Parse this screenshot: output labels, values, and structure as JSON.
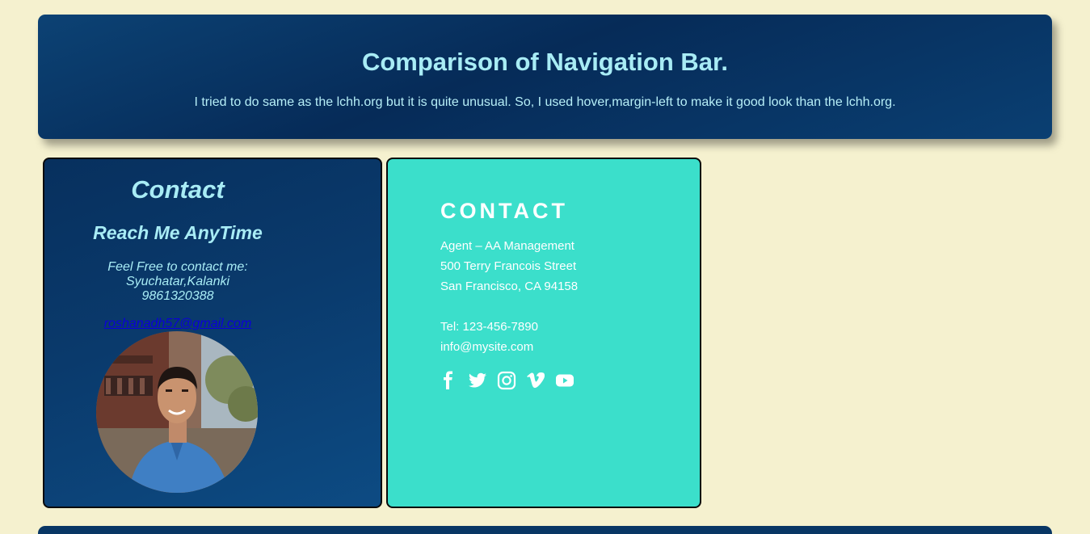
{
  "header": {
    "title": "Comparison of Navigation Bar.",
    "description": "I tried to do same as the lchh.org but it is quite unusual. So, I used hover,margin-left to make it good look than the lchh.org."
  },
  "left_card": {
    "title": "Contact",
    "subtitle": "Reach Me AnyTime",
    "line1": "Feel Free to contact me:",
    "line2": "Syuchatar,Kalanki",
    "line3": "9861320388",
    "email": "roshanadh57@gmail.com",
    "photo_icon": "profile-photo"
  },
  "right_card": {
    "title": "CONTACT",
    "address1": "Agent – AA  Management",
    "address2": "500 Terry Francois Street",
    "address3": "San Francisco, CA 94158",
    "tel": "Tel: 123-456-7890",
    "email": "info@mysite.com",
    "social_icons": [
      "facebook-icon",
      "twitter-icon",
      "instagram-icon",
      "vimeo-icon",
      "youtube-icon"
    ]
  },
  "colors": {
    "background": "#f5f1cf",
    "navy": "#083664",
    "teal": "#3bdfcb",
    "light_text": "#a8ecf5"
  }
}
